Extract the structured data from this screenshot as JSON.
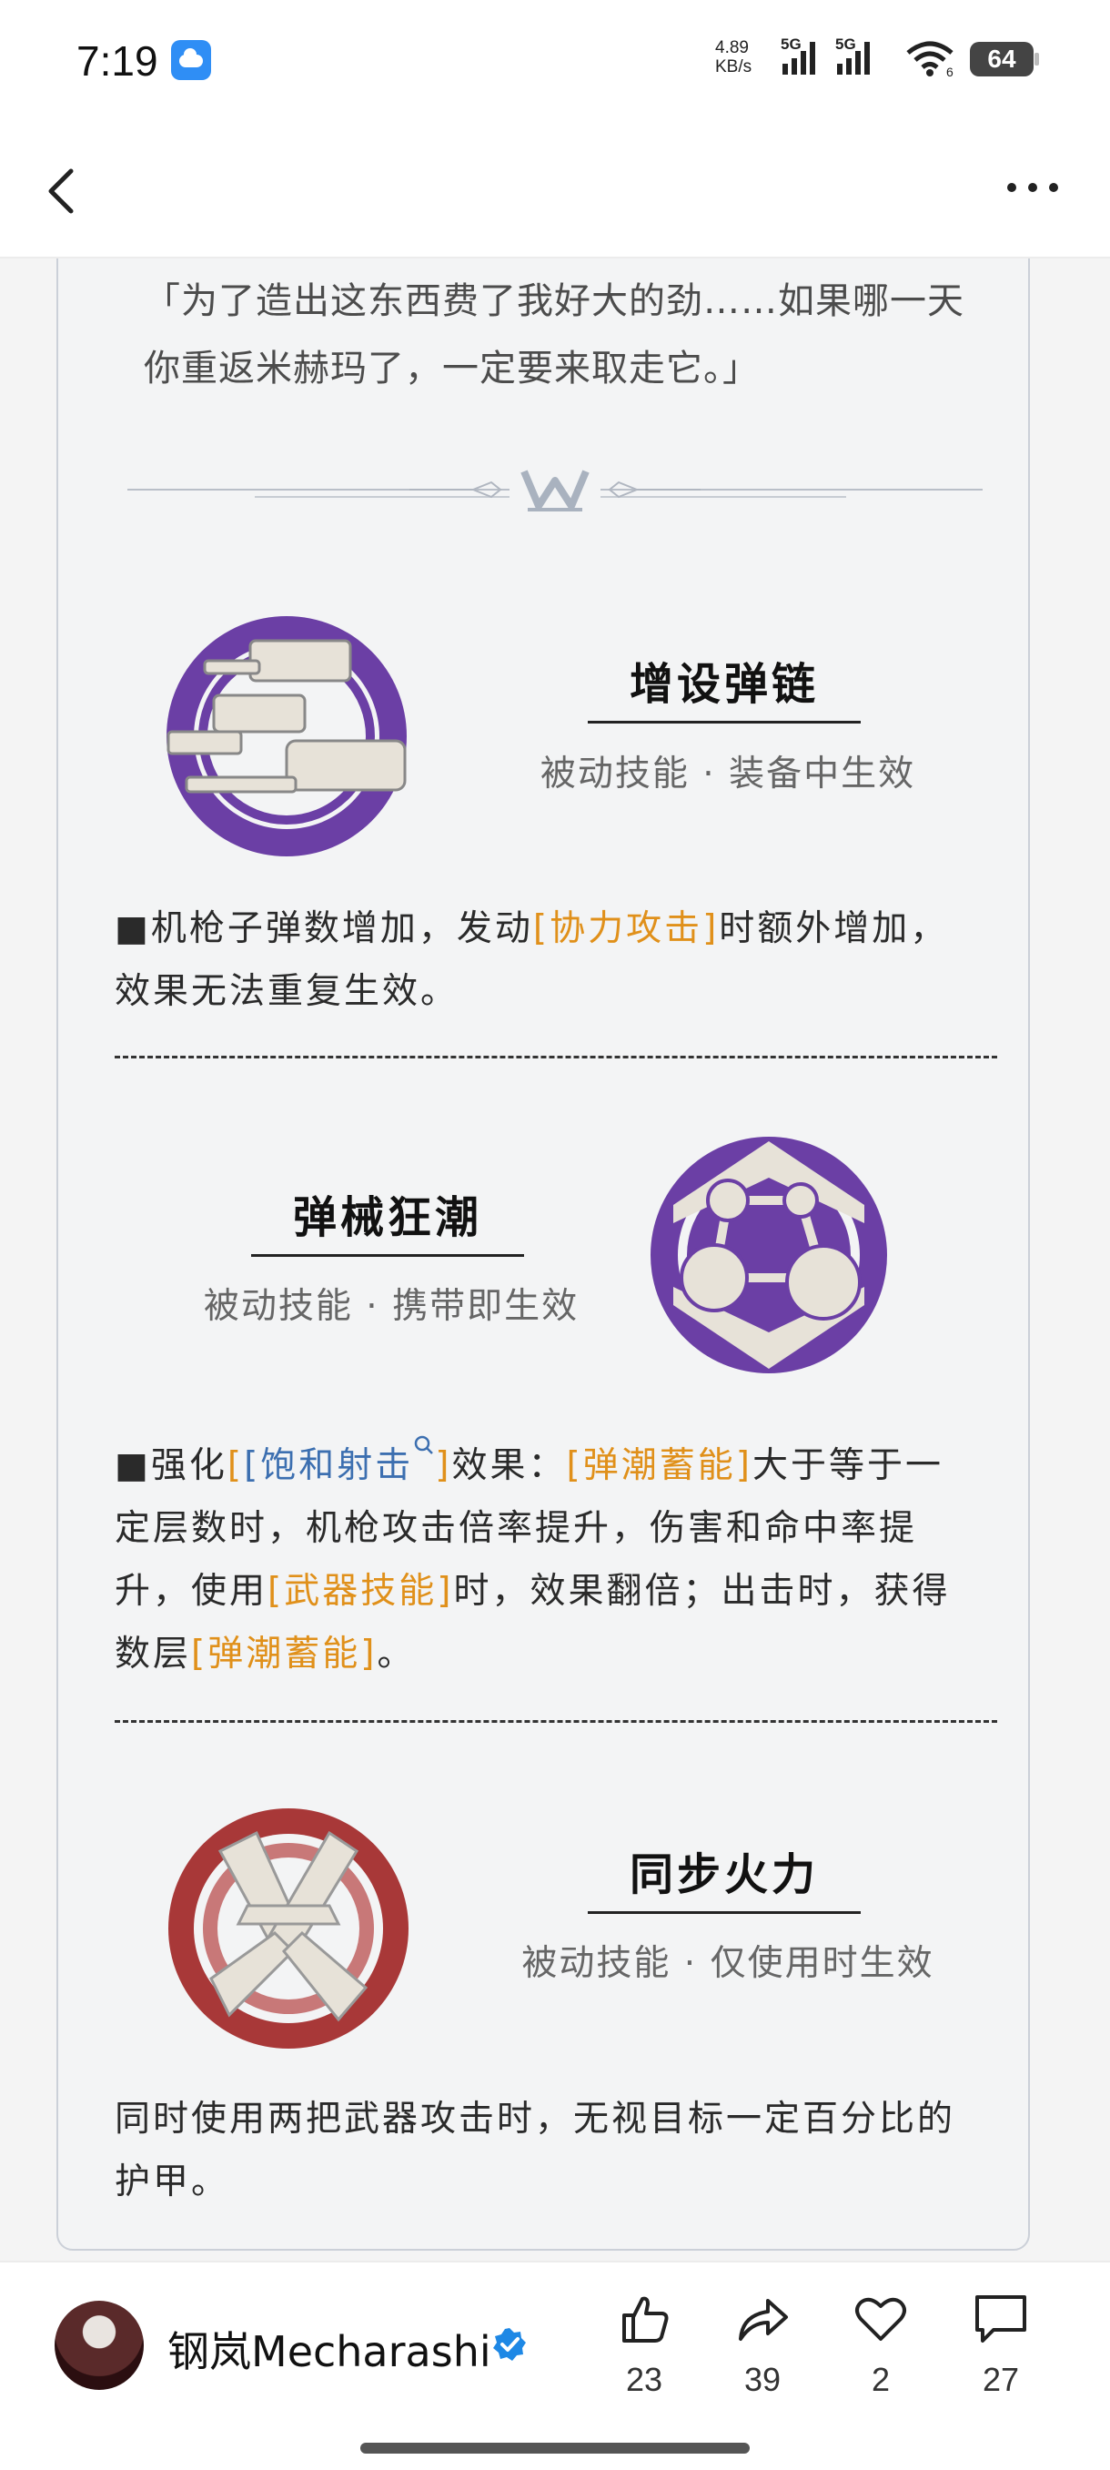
{
  "status_bar": {
    "time": "7:19",
    "net_speed_value": "4.89",
    "net_speed_unit": "KB/s",
    "sim1_label": "5G",
    "sim2_label": "5G",
    "wifi_sub": "6",
    "battery": "64",
    "weather_icon": "weather-cloud-icon"
  },
  "nav": {
    "back_icon": "chevron-left-icon",
    "more_icon": "more-dots-icon"
  },
  "article": {
    "quote_line1": "「为了造出这东西费了我好大的劲……如果哪一天",
    "quote_line2": "你重返米赫玛了，一定要来取走它。」",
    "skills": [
      {
        "title": "增设弹链",
        "subtitle": "被动技能 · 装备中生效",
        "desc_prefix": "■机枪子弹数增加，发动",
        "desc_kw1": "[协力攻击]",
        "desc_after_kw1": "时额外增加，",
        "desc_line2": "效果无法重复生效。",
        "icon": "ammo-belt-icon",
        "icon_color": "#6b3fa5"
      },
      {
        "title": "弹械狂潮",
        "subtitle": "被动技能 · 携带即生效",
        "desc_prefix": "■强化",
        "desc_link": "[饱和射击",
        "desc_link_end": "]",
        "desc_a": "效果：",
        "desc_kw1": "[弹潮蓄能]",
        "desc_b": "大于等于一",
        "desc_line2": "定层数时，机枪攻击倍率提升，伤害和命中率提",
        "desc_c": "升，使用",
        "desc_kw2": "[武器技能]",
        "desc_d": "时，效果翻倍；出击时，获得",
        "desc_e": "数层",
        "desc_kw3": "[弹潮蓄能]",
        "desc_f": "。",
        "icon": "network-nodes-icon",
        "icon_color": "#6b3fa5"
      },
      {
        "title": "同步火力",
        "subtitle": "被动技能 · 仅使用时生效",
        "desc_line1": "同时使用两把武器攻击时，无视目标一定百分比的",
        "desc_line2": "护甲。",
        "icon": "crossed-blades-icon",
        "icon_color": "#a83838"
      }
    ]
  },
  "bottom_bar": {
    "author": "钢岚Mecharashi",
    "actions": [
      {
        "name": "like",
        "icon": "thumbs-up-icon",
        "count": "23"
      },
      {
        "name": "share",
        "icon": "share-icon",
        "count": "39"
      },
      {
        "name": "favorite",
        "icon": "heart-icon",
        "count": "2"
      },
      {
        "name": "comment",
        "icon": "comment-icon",
        "count": "27"
      }
    ]
  },
  "colors": {
    "keyword_orange": "#e0901a",
    "link_blue": "#3c6fb0",
    "verified_blue": "#1e88e5"
  }
}
